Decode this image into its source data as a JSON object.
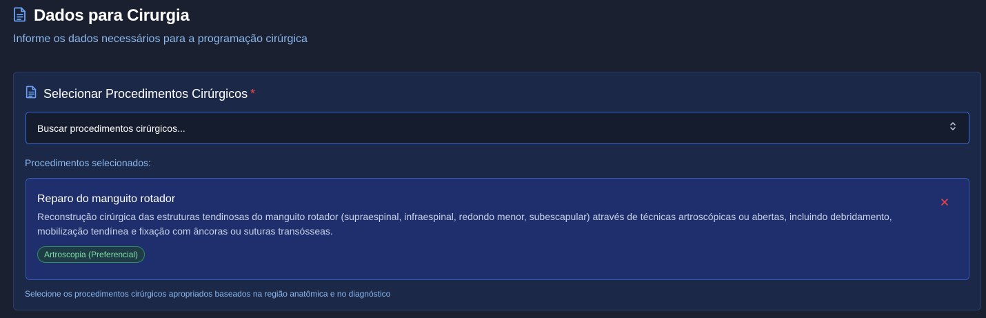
{
  "header": {
    "title": "Dados para Cirurgia",
    "subtitle": "Informe os dados necessários para a programação cirúrgica",
    "icon": "document-icon"
  },
  "section": {
    "title": "Selecionar Procedimentos Cirúrgicos",
    "required_mark": "*",
    "icon": "document-icon",
    "search": {
      "placeholder": "Buscar procedimentos cirúrgicos...",
      "icon": "chevron-up-down-icon"
    },
    "selected_label": "Procedimentos selecionados:",
    "procedures": [
      {
        "name": "Reparo do manguito rotador",
        "description": "Reconstrução cirúrgica das estruturas tendinosas do manguito rotador (supraespinal, infraespinal, redondo menor, subescapular) através de técnicas artroscópicas ou abertas, incluindo debridamento, mobilização tendínea e fixação com âncoras ou suturas transósseas.",
        "tag": "Artroscopia (Preferencial)",
        "remove_icon": "close-icon"
      }
    ],
    "helper": "Selecione os procedimentos cirúrgicos apropriados baseados na região anatômica e no diagnóstico"
  },
  "colors": {
    "background": "#1a2030",
    "card": "#1b2847",
    "accent": "#3b6ed9",
    "required": "#ef4444",
    "tag_text": "#7ee0a6",
    "muted_text": "#8cb8ee"
  }
}
